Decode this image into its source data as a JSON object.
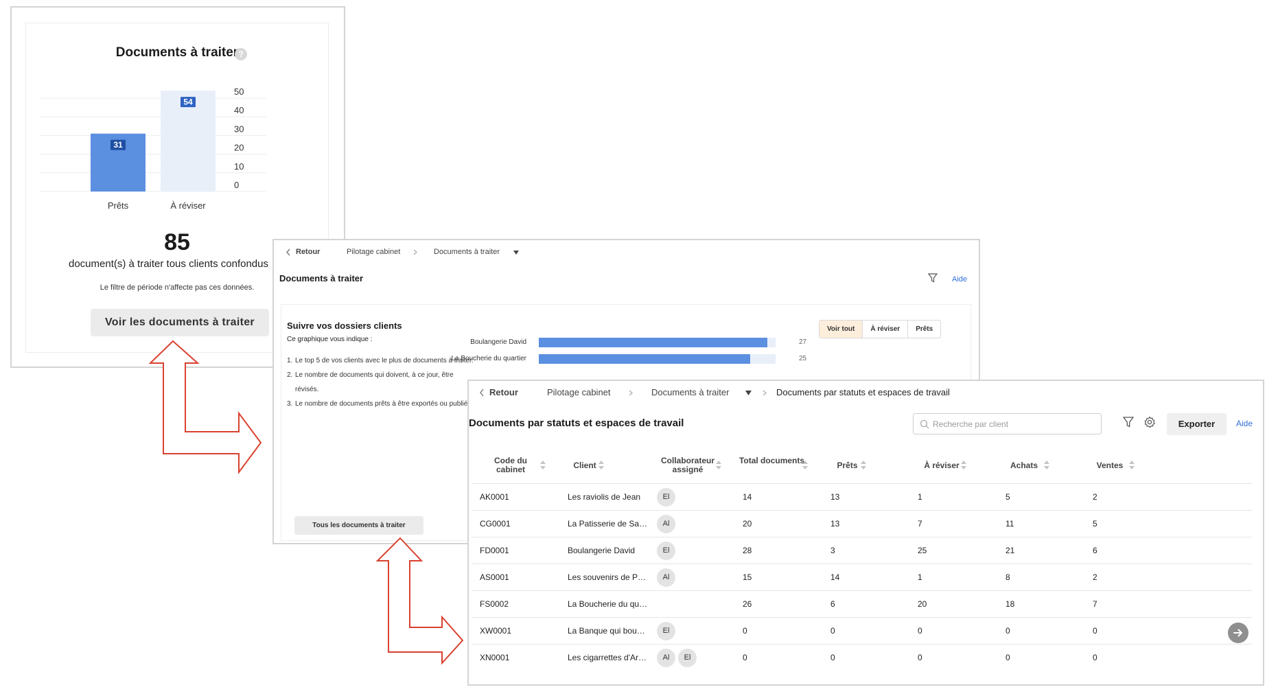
{
  "panel1": {
    "title": "Documents à traiter",
    "help_icon": "?",
    "chart_data": {
      "type": "bar",
      "categories": [
        "Prêts",
        "À réviser"
      ],
      "values": [
        31,
        54
      ],
      "ylim": [
        0,
        50
      ],
      "yticks": [
        "50",
        "40",
        "30",
        "20",
        "10",
        "0"
      ],
      "grid": true,
      "colors": [
        "#5b8fe0",
        "#e9eff9"
      ],
      "label_colors": [
        "#1f4fa3",
        "#2e63c2"
      ]
    },
    "total": "85",
    "caption": "document(s) à traiter tous clients confondus",
    "filter_note": "Le filtre de période n'affecte pas ces données.",
    "button_label": "Voir les documents à traiter"
  },
  "panel2": {
    "breadcrumb": {
      "back": "Retour",
      "item1": "Pilotage cabinet",
      "item2": "Documents à traiter"
    },
    "title": "Documents à traiter",
    "aide": "Aide",
    "section_title": "Suivre vos dossiers clients",
    "intro": "Ce graphique vous indique :",
    "list": [
      {
        "n": "1.",
        "text": "Le top 5 de vos clients avec le plus de documents à traiter."
      },
      {
        "n": "2.",
        "text": "Le nombre de documents qui doivent, à ce jour, être révisés."
      },
      {
        "n": "3.",
        "text": "Le nombre de documents prêts à être exportés ou publiés."
      }
    ],
    "toggle": [
      "Voir tout",
      "À réviser",
      "Prêts"
    ],
    "chart_data": {
      "type": "bar",
      "orientation": "horizontal",
      "categories": [
        "Boulangerie David",
        "La Boucherie du quartier"
      ],
      "values": [
        27,
        25
      ],
      "max": 28,
      "value_labels": [
        "27",
        "25"
      ]
    },
    "button_label": "Tous les documents à traiter"
  },
  "panel3": {
    "breadcrumb": {
      "back": "Retour",
      "item1": "Pilotage cabinet",
      "item2": "Documents à traiter",
      "item3": "Documents par statuts et espaces de travail"
    },
    "title": "Documents par statuts et espaces de travail",
    "search_placeholder": "Recherche par client",
    "export": "Exporter",
    "aide": "Aide",
    "columns": [
      "Code du cabinet",
      "Client",
      "Collaborateur assigné",
      "Total documents",
      "Prêts",
      "À réviser",
      "Achats",
      "Ventes"
    ],
    "rows": [
      {
        "code": "AK0001",
        "client": "Les raviolis de Jean",
        "collab": [
          "El"
        ],
        "total": "14",
        "prets": "13",
        "reviser": "1",
        "achats": "5",
        "ventes": "2"
      },
      {
        "code": "CG0001",
        "client": "La Patisserie de Sa…",
        "collab": [
          "Al"
        ],
        "total": "20",
        "prets": "13",
        "reviser": "7",
        "achats": "11",
        "ventes": "5"
      },
      {
        "code": "FD0001",
        "client": "Boulangerie David",
        "collab": [
          "El"
        ],
        "total": "28",
        "prets": "3",
        "reviser": "25",
        "achats": "21",
        "ventes": "6"
      },
      {
        "code": "AS0001",
        "client": "Les souvenirs de P…",
        "collab": [
          "Al"
        ],
        "total": "15",
        "prets": "14",
        "reviser": "1",
        "achats": "8",
        "ventes": "2"
      },
      {
        "code": "FS0002",
        "client": "La Boucherie du qu…",
        "collab": [],
        "total": "26",
        "prets": "6",
        "reviser": "20",
        "achats": "18",
        "ventes": "7"
      },
      {
        "code": "XW0001",
        "client": "La Banque qui bou…",
        "collab": [
          "El"
        ],
        "total": "0",
        "prets": "0",
        "reviser": "0",
        "achats": "0",
        "ventes": "0"
      },
      {
        "code": "XN0001",
        "client": "Les cigarrettes d'Ar…",
        "collab": [
          "Al",
          "El"
        ],
        "total": "0",
        "prets": "0",
        "reviser": "0",
        "achats": "0",
        "ventes": "0"
      }
    ]
  },
  "icons": [
    "question-icon",
    "chevron-left-icon",
    "chevron-right-icon",
    "caret-down-icon",
    "filter-icon",
    "gear-icon",
    "search-icon",
    "sort-icon",
    "arrow-right-circle-icon",
    "double-arrow-icon"
  ],
  "colors": {
    "accent": "#2f6fd6",
    "bar": "#5b8fe0",
    "bar_track": "#e9eff9",
    "arrow": "#d9412f",
    "active_tab": "#fdeedc"
  }
}
